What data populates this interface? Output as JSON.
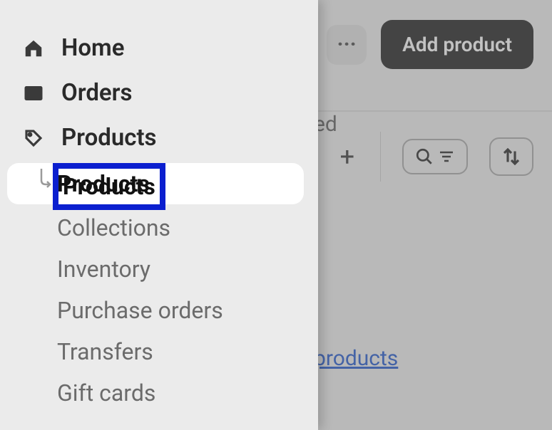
{
  "header": {
    "more_label": "···",
    "add_product_label": "Add product"
  },
  "toolbar": {
    "partial_text": "ed",
    "plus_label": "+",
    "link_text": "products"
  },
  "sidebar": {
    "items": [
      {
        "label": "Home",
        "icon": "home-icon"
      },
      {
        "label": "Orders",
        "icon": "inbox-icon"
      },
      {
        "label": "Products",
        "icon": "tag-icon"
      }
    ],
    "sub_items": [
      {
        "label": "Products",
        "active": true
      },
      {
        "label": "Collections"
      },
      {
        "label": "Inventory"
      },
      {
        "label": "Purchase orders"
      },
      {
        "label": "Transfers"
      },
      {
        "label": "Gift cards"
      }
    ]
  }
}
